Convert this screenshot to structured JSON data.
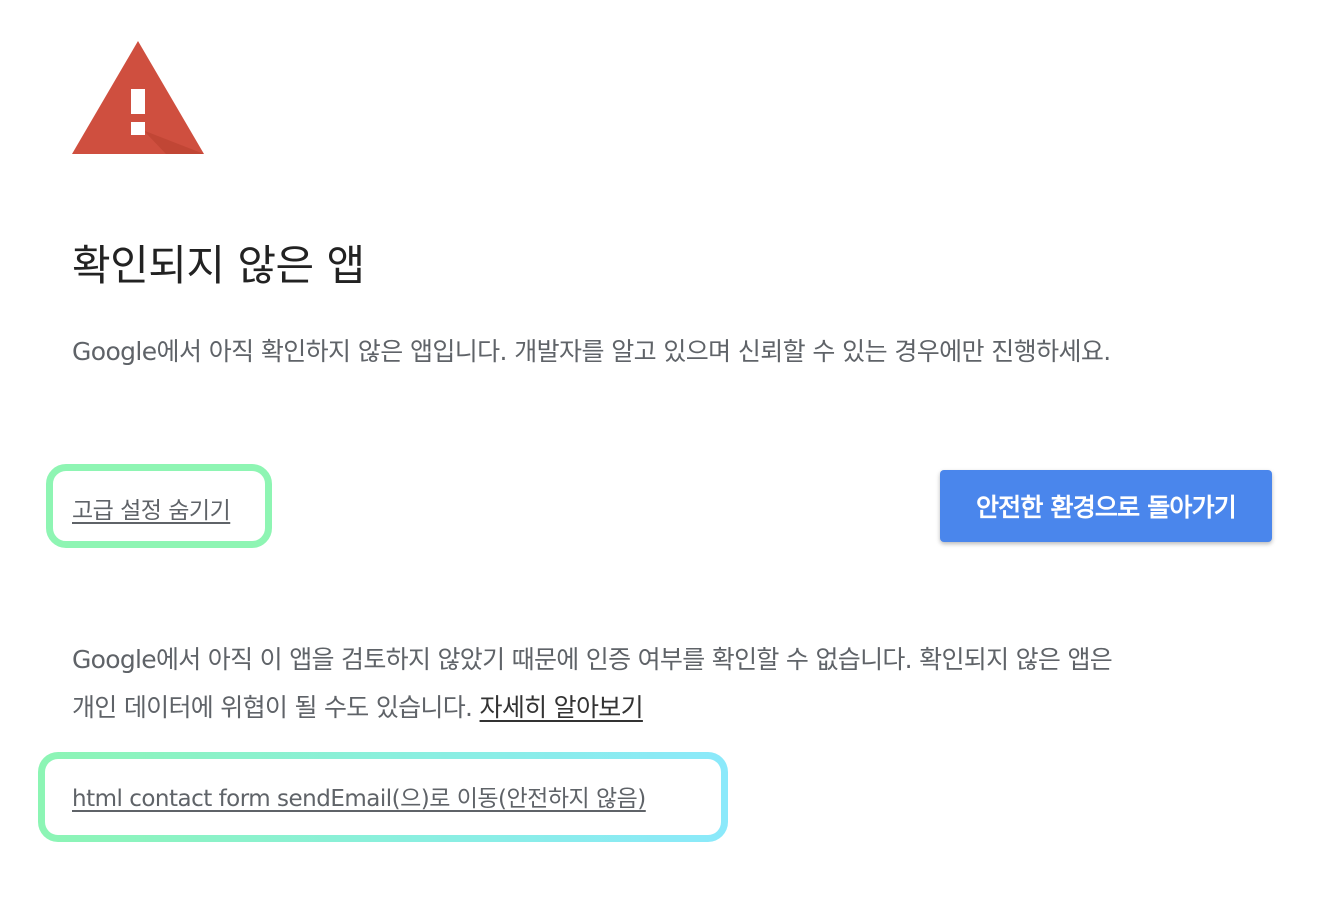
{
  "icon": {
    "name": "warning-icon",
    "triangle_color": "#cf4f3f",
    "shadow_color": "#b8412f",
    "mark_color": "#ffffff"
  },
  "title": "확인되지 않은 앱",
  "intro": "Google에서 아직 확인하지 않은 앱입니다. 개발자를 알고 있으며 신뢰할 수 있는 경우에만 진행하세요.",
  "advanced_toggle_label": "고급 설정 숨기기",
  "back_button_label": "안전한 환경으로 돌아가기",
  "details": {
    "line1": "Google에서 아직 이 앱을 검토하지 않았기 때문에 인증 여부를 확인할 수 없습니다. 확인되지 않은 앱은",
    "line2": "개인 데이터에 위협이 될 수도 있습니다. ",
    "learn_more_label": "자세히 알아보기"
  },
  "proceed_link_label": "html contact form sendEmail(으)로 이동(안전하지 않음)",
  "colors": {
    "primary_button": "#4a86ec",
    "highlight_green": "#8ef5b3",
    "highlight_cyan": "#8be9fb",
    "body_text": "#5f6368"
  }
}
